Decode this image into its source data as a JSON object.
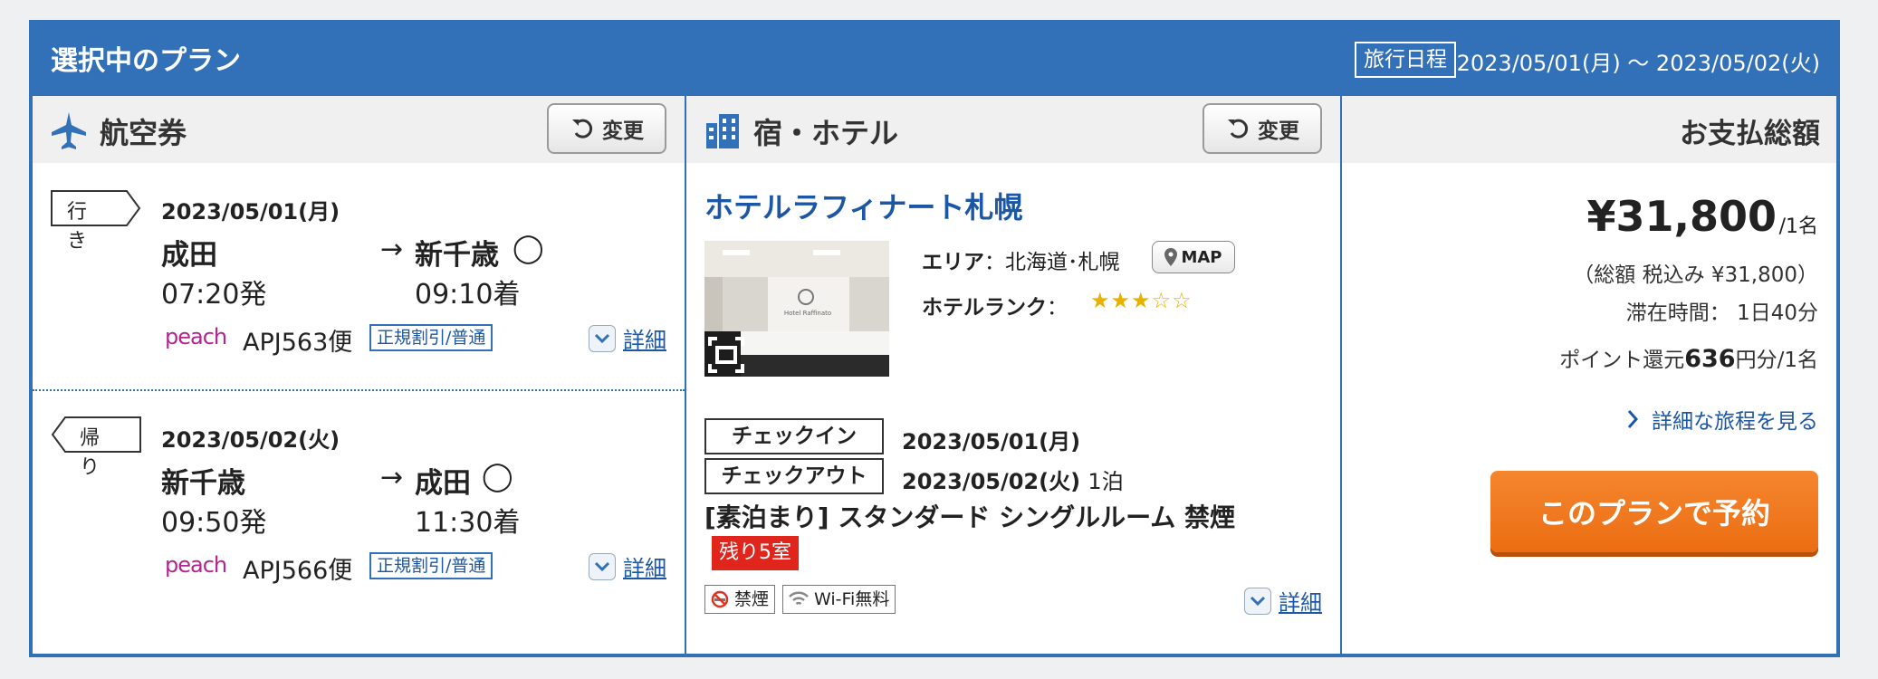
{
  "header": {
    "title": "選択中のプラン",
    "trip_label": "旅行日程",
    "trip_dates": "2023/05/01(月) 〜 2023/05/02(火)"
  },
  "flight": {
    "title": "航空券",
    "change_label": "変更",
    "outbound": {
      "tag": "行き",
      "date": "2023/05/01(月)",
      "from": "成田",
      "to": "新千歳",
      "arrow": "→",
      "mark": "◯",
      "dep_time": "07:20発",
      "arr_time": "09:10着",
      "airline": "peach",
      "flight_no": "APJ563便",
      "fare": "正規割引/普通",
      "detail_label": "詳細"
    },
    "inbound": {
      "tag": "帰り",
      "date": "2023/05/02(火)",
      "from": "新千歳",
      "to": "成田",
      "arrow": "→",
      "mark": "◯",
      "dep_time": "09:50発",
      "arr_time": "11:30着",
      "airline": "peach",
      "flight_no": "APJ566便",
      "fare": "正規割引/普通",
      "detail_label": "詳細"
    }
  },
  "hotel": {
    "title": "宿・ホテル",
    "change_label": "変更",
    "name": "ホテルラフィナート札幌",
    "area_label": "エリア",
    "area_sep": "：",
    "area": "北海道･札幌",
    "map_label": "MAP",
    "rank_label": "ホテルランク",
    "rank_sep": "：",
    "rank": 3,
    "stars_text": "★★★☆☆",
    "checkin_label": "チェックイン",
    "checkin_date": "2023/05/01(月)",
    "checkout_label": "チェックアウト",
    "checkout_date": "2023/05/02(火)",
    "nights": "1泊",
    "room": "[素泊まり] スタンダード シングルルーム 禁煙",
    "remaining": "残り5室",
    "amenities": [
      "禁煙",
      "Wi-Fi無料"
    ],
    "detail_label": "詳細",
    "image_sign": "Hotel Raffinato"
  },
  "payment": {
    "title": "お支払総額",
    "price": "¥31,800",
    "per_person": "/1名",
    "total_note": "（総額 税込み ¥31,800）",
    "stay_label": "滞在時間：",
    "stay_value": "1日40分",
    "points_prefix": "ポイント還元",
    "points_value": "636",
    "points_suffix": "円分/1名",
    "itinerary_link": "詳細な旅程を見る",
    "book_label": "このプランで予約"
  },
  "colors": {
    "brand_blue": "#3270b8",
    "link_blue": "#1c57a6",
    "book_orange": "#ec6d12",
    "remain_red": "#e0251c",
    "peach": "#b4248f",
    "star": "#e8b100"
  }
}
